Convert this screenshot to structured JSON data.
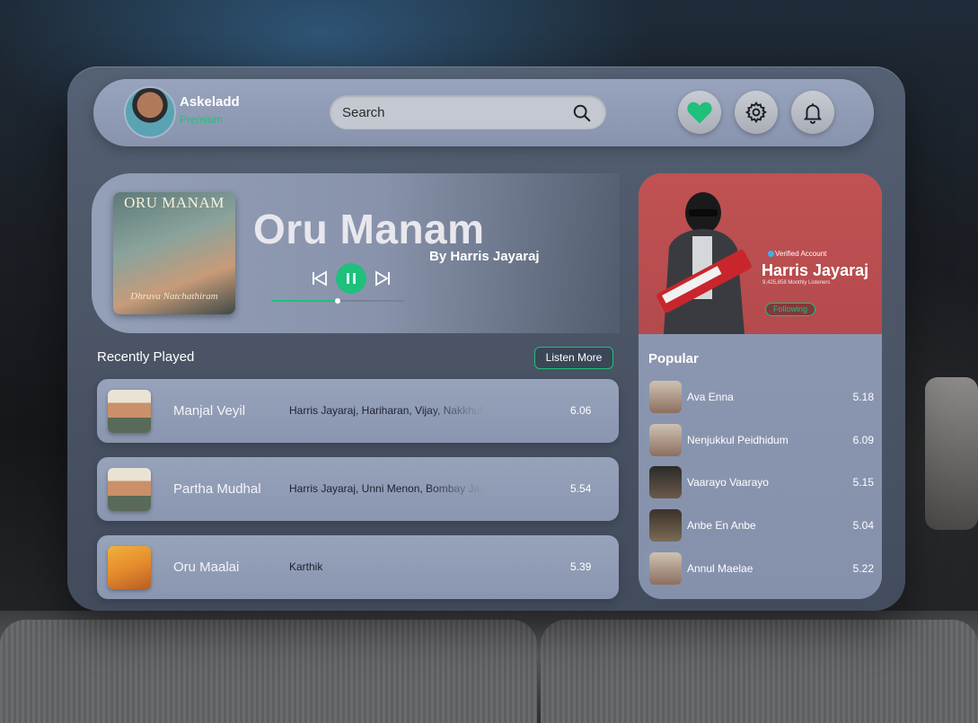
{
  "header": {
    "username": "Askeladd",
    "plan": "Premium",
    "search_placeholder": "Search",
    "icons": [
      "heart-icon",
      "gear-icon",
      "bell-icon"
    ]
  },
  "now_playing": {
    "cover_title": "ORU MANAM",
    "cover_subtitle": "Dhruva Natchathiram",
    "title": "Oru Manam",
    "artist": "By Harris Jayaraj",
    "progress": 0.5
  },
  "recently_played": {
    "title": "Recently Played",
    "listen_more": "Listen More",
    "items": [
      {
        "song": "Manjal Veyil",
        "artists": "Harris Jayaraj, Hariharan, Vijay, Nakkhul",
        "duration": "6.06"
      },
      {
        "song": "Partha Mudhal",
        "artists": "Harris Jayaraj, Unni Menon, Bombay Jayashri",
        "duration": "5.54"
      },
      {
        "song": "Oru Maalai",
        "artists": "Karthik",
        "duration": "5.39"
      }
    ]
  },
  "artist_card": {
    "verified": "Verified Account",
    "name": "Harris Jayaraj",
    "listeners": "9,425,858 Monthly Listeners",
    "follow_label": "Following",
    "popular_title": "Popular",
    "popular": [
      {
        "song": "Ava Enna",
        "duration": "5.18"
      },
      {
        "song": "Nenjukkul Peidhidum",
        "duration": "6.09"
      },
      {
        "song": "Vaarayo Vaarayo",
        "duration": "5.15"
      },
      {
        "song": "Anbe En Anbe",
        "duration": "5.04"
      },
      {
        "song": "Annul Maelae",
        "duration": "5.22"
      }
    ]
  },
  "colors": {
    "accent": "#1fbf7c",
    "artist_hero": "#c05252",
    "heart": "#1fbf7c"
  }
}
